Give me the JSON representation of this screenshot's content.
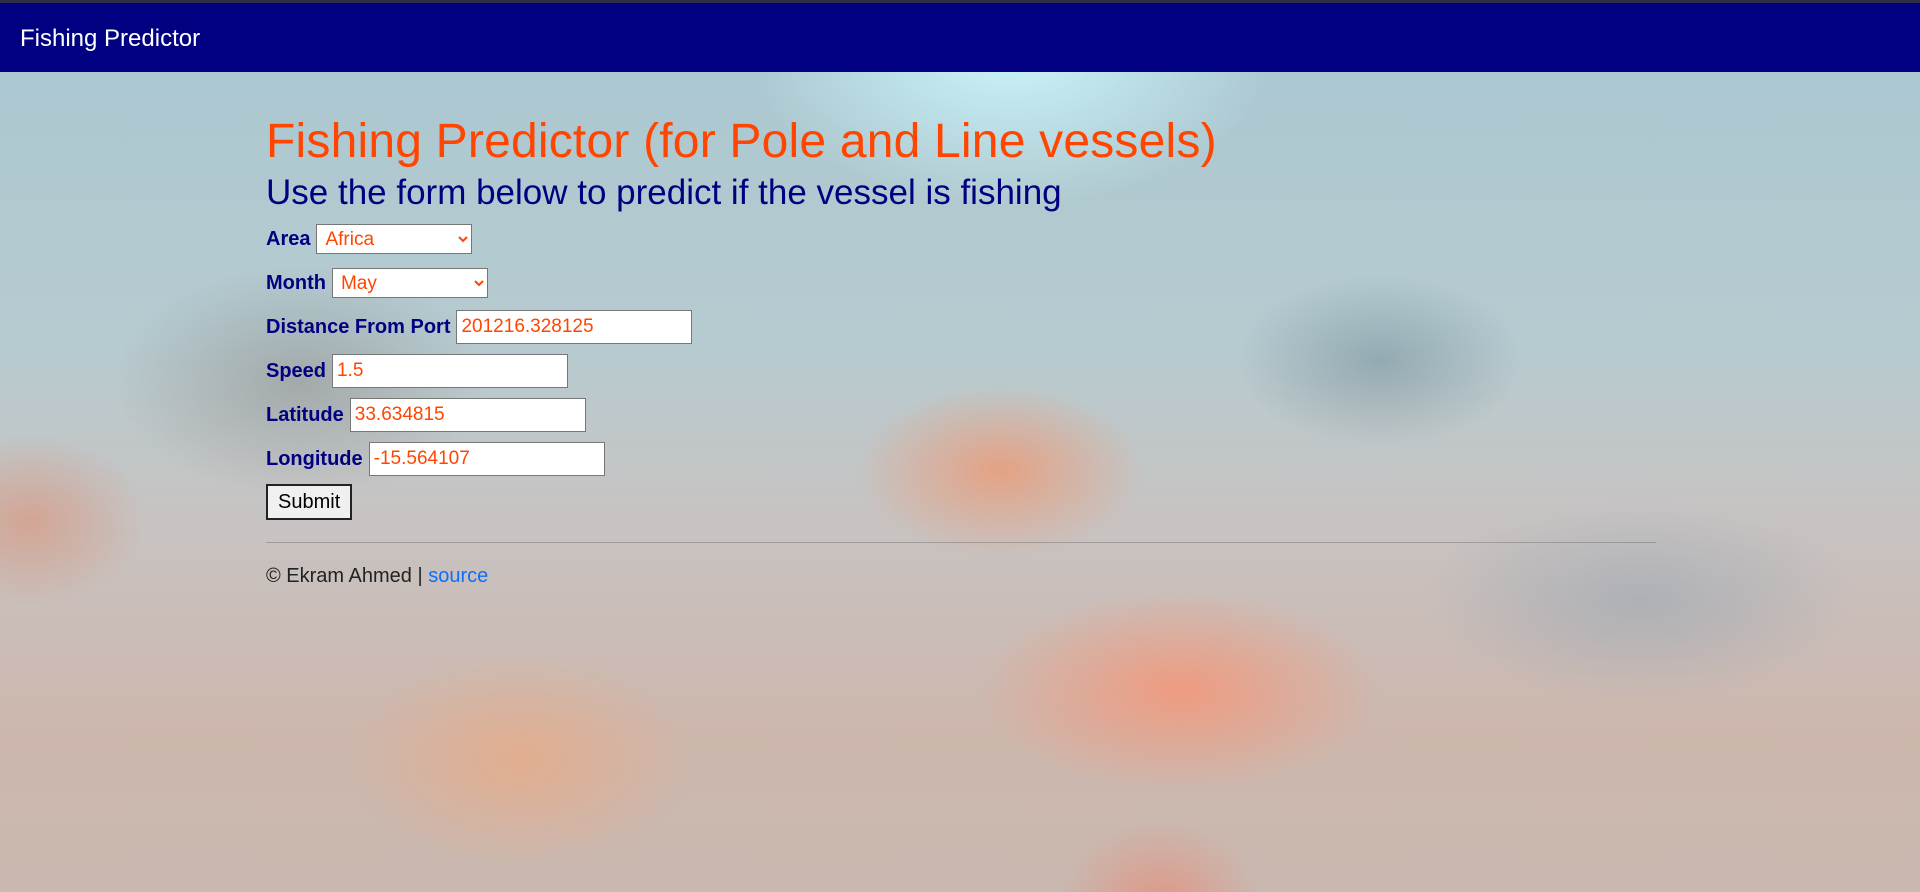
{
  "navbar": {
    "brand": "Fishing Predictor"
  },
  "main": {
    "title": "Fishing Predictor (for Pole and Line vessels)",
    "subtitle": "Use the form below to predict if the vessel is fishing"
  },
  "form": {
    "area": {
      "label": "Area",
      "selected": "Africa"
    },
    "month": {
      "label": "Month",
      "selected": "May"
    },
    "distance_from_port": {
      "label": "Distance From Port",
      "value": "201216.328125"
    },
    "speed": {
      "label": "Speed",
      "value": "1.5"
    },
    "latitude": {
      "label": "Latitude",
      "value": "33.634815"
    },
    "longitude": {
      "label": "Longitude",
      "value": "-15.564107"
    },
    "submit_label": "Submit"
  },
  "footer": {
    "copyright": "© Ekram Ahmed |",
    "link_label": "source"
  },
  "colors": {
    "navbar": "#000080",
    "title": "#ff4500",
    "subtitle": "#000080",
    "input_text": "#ff4500",
    "link": "#0d6efd"
  }
}
